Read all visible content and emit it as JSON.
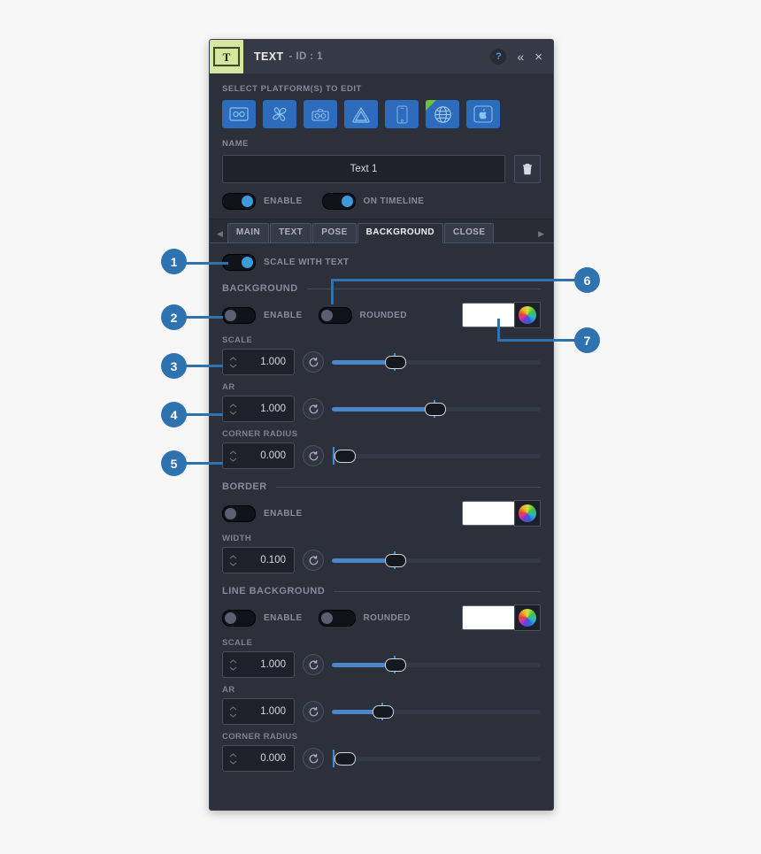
{
  "window": {
    "logo_letter": "T",
    "title": "TEXT",
    "subtitle": "- ID : 1",
    "help_label": "?",
    "collapse_label": "«",
    "close_label": "×"
  },
  "platform_section": {
    "label": "SELECT PLATFORM(S) TO EDIT",
    "items": [
      {
        "name": "vr-headset-icon",
        "selected": true
      },
      {
        "name": "pinwheel-icon",
        "selected": true
      },
      {
        "name": "robot-headset-icon",
        "selected": true
      },
      {
        "name": "triangle-outline-icon",
        "selected": true
      },
      {
        "name": "mobile-phone-icon",
        "selected": true
      },
      {
        "name": "globe-web-icon",
        "selected": true,
        "badge": true
      },
      {
        "name": "apple-icon",
        "selected": true
      }
    ]
  },
  "name_section": {
    "label": "NAME",
    "value": "Text 1",
    "placeholder": "Text 1",
    "delete_icon": "trash-icon"
  },
  "top_toggles": [
    {
      "label": "ENABLE",
      "on": true
    },
    {
      "label": "ON TIMELINE",
      "on": true
    }
  ],
  "tabs": {
    "prev_arrow": "◀",
    "next_arrow": "▶",
    "items": [
      {
        "label": "MAIN",
        "active": false
      },
      {
        "label": "TEXT",
        "active": false
      },
      {
        "label": "POSE",
        "active": false
      },
      {
        "label": "BACKGROUND",
        "active": true
      },
      {
        "label": "CLOSE",
        "active": false
      }
    ]
  },
  "scale_with_text": {
    "label": "SCALE WITH TEXT",
    "on": true
  },
  "groups": [
    {
      "title": "BACKGROUND",
      "enable": {
        "label": "ENABLE",
        "on": false
      },
      "rounded": {
        "label": "ROUNDED",
        "on": false
      },
      "color": "#ffffff",
      "fields": [
        {
          "label": "SCALE",
          "value": "1.000",
          "slider_pct": 26,
          "tick_pct": 30
        },
        {
          "label": "AR",
          "value": "1.000",
          "slider_pct": 49,
          "tick_pct": 49
        },
        {
          "label": "CORNER RADIUS",
          "value": "0.000",
          "slider_pct": 0,
          "tick_pct": 1
        }
      ]
    },
    {
      "title": "BORDER",
      "enable": {
        "label": "ENABLE",
        "on": false
      },
      "rounded": null,
      "color": "#ffffff",
      "fields": [
        {
          "label": "WIDTH",
          "value": "0.100",
          "slider_pct": 26,
          "tick_pct": 30
        }
      ]
    },
    {
      "title": "LINE BACKGROUND",
      "enable": {
        "label": "ENABLE",
        "on": false
      },
      "rounded": {
        "label": "ROUNDED",
        "on": false
      },
      "color": "#ffffff",
      "fields": [
        {
          "label": "SCALE",
          "value": "1.000",
          "slider_pct": 26,
          "tick_pct": 30
        },
        {
          "label": "AR",
          "value": "1.000",
          "slider_pct": 21,
          "tick_pct": 24
        },
        {
          "label": "CORNER RADIUS",
          "value": "0.000",
          "slider_pct": 0,
          "tick_pct": 1
        }
      ]
    }
  ],
  "callouts": [
    {
      "number": "1"
    },
    {
      "number": "2"
    },
    {
      "number": "3"
    },
    {
      "number": "4"
    },
    {
      "number": "5"
    },
    {
      "number": "6"
    },
    {
      "number": "7"
    }
  ],
  "colors": {
    "accent": "#3c9adb",
    "callout": "#2f72b0",
    "panel_bg": "#2b303a",
    "titlebar_bg": "#343a46",
    "logo_bg": "#d4e79e",
    "platform_selected": "#2d6bbd",
    "swatch": "#ffffff",
    "slider_fill": "#4a86c8"
  }
}
